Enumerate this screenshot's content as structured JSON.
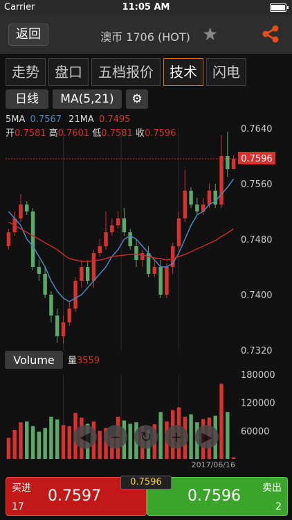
{
  "status": {
    "carrier": "Carrier",
    "time": "11:05 AM"
  },
  "header": {
    "back": "返回",
    "title": "澳币 1706 (HOT)"
  },
  "tabs": [
    "走势",
    "盘口",
    "五档报价",
    "技术",
    "闪电"
  ],
  "toolbar": {
    "period": "日线",
    "indicator": "MA(5,21)"
  },
  "ma": {
    "ma5_label": "5MA",
    "ma5": "0.7567",
    "ma21_label": "21MA",
    "ma21": "0.7495"
  },
  "ohlc": {
    "open_label": "开",
    "open": "0.7581",
    "high_label": "高",
    "high": "0.7601",
    "low_label": "低",
    "low": "0.7581",
    "close_label": "收",
    "close": "0.7596"
  },
  "price_axis": {
    "ticks": [
      "0.7640",
      "0.7560",
      "0.7480",
      "0.7400",
      "0.7320"
    ],
    "current": "0.7596"
  },
  "volume": {
    "button": "Volume",
    "label": "量",
    "value": "3559",
    "ticks": [
      "180000",
      "120000",
      "60000"
    ],
    "date": "2017/06/16"
  },
  "trade": {
    "buy_label": "买进",
    "buy_qty": "17",
    "buy_price": "0.7597",
    "sell_label": "卖出",
    "sell_qty": "2",
    "sell_price": "0.7596",
    "last": "0.7596"
  },
  "colors": {
    "up": "#d6322e",
    "down": "#5aa86a",
    "ma5": "#4a88c8",
    "ma21": "#c82a2a",
    "accent": "#e07020"
  },
  "chart_data": {
    "type": "candlestick",
    "ylim": [
      0.732,
      0.764
    ],
    "open": [
      0.747,
      0.749,
      0.751,
      0.753,
      0.752,
      0.744,
      0.743,
      0.74,
      0.737,
      0.734,
      0.736,
      0.738,
      0.742,
      0.744,
      0.742,
      0.746,
      0.747,
      0.749,
      0.75,
      0.751,
      0.749,
      0.747,
      0.745,
      0.746,
      0.743,
      0.744,
      0.74,
      0.744,
      0.747,
      0.751,
      0.755,
      0.753,
      0.752,
      0.753,
      0.755,
      0.753,
      0.76,
      0.7581
    ],
    "close": [
      0.749,
      0.751,
      0.753,
      0.752,
      0.744,
      0.743,
      0.74,
      0.737,
      0.734,
      0.736,
      0.738,
      0.742,
      0.744,
      0.742,
      0.746,
      0.747,
      0.749,
      0.75,
      0.751,
      0.749,
      0.747,
      0.745,
      0.746,
      0.743,
      0.744,
      0.74,
      0.744,
      0.747,
      0.751,
      0.755,
      0.753,
      0.752,
      0.753,
      0.755,
      0.753,
      0.76,
      0.7581,
      0.7596
    ],
    "high": [
      0.7495,
      0.752,
      0.7545,
      0.7535,
      0.7525,
      0.745,
      0.744,
      0.7405,
      0.738,
      0.737,
      0.739,
      0.7425,
      0.745,
      0.745,
      0.7465,
      0.748,
      0.752,
      0.751,
      0.752,
      0.7525,
      0.7495,
      0.748,
      0.7465,
      0.747,
      0.745,
      0.745,
      0.7445,
      0.7475,
      0.752,
      0.758,
      0.7555,
      0.754,
      0.754,
      0.756,
      0.756,
      0.763,
      0.7635,
      0.7601
    ],
    "low": [
      0.7465,
      0.7485,
      0.7505,
      0.7515,
      0.7435,
      0.742,
      0.7395,
      0.736,
      0.733,
      0.733,
      0.7355,
      0.7375,
      0.741,
      0.7415,
      0.741,
      0.7455,
      0.7465,
      0.7485,
      0.7495,
      0.7485,
      0.7465,
      0.744,
      0.744,
      0.7425,
      0.7425,
      0.7395,
      0.7395,
      0.743,
      0.7465,
      0.7505,
      0.7525,
      0.7515,
      0.7515,
      0.7525,
      0.7525,
      0.7525,
      0.757,
      0.7581
    ],
    "ma5": [
      0.752,
      0.751,
      0.75,
      0.748,
      0.747,
      0.7455,
      0.744,
      0.742,
      0.7405,
      0.7395,
      0.739,
      0.7395,
      0.74,
      0.741,
      0.742,
      0.743,
      0.744,
      0.7455,
      0.7465,
      0.748,
      0.7485,
      0.748,
      0.747,
      0.746,
      0.745,
      0.744,
      0.744,
      0.7445,
      0.746,
      0.748,
      0.75,
      0.7515,
      0.752,
      0.753,
      0.7535,
      0.7545,
      0.7555,
      0.7567
    ],
    "ma21": [
      0.7505,
      0.75,
      0.7495,
      0.749,
      0.7485,
      0.748,
      0.7475,
      0.747,
      0.7465,
      0.7458,
      0.7452,
      0.745,
      0.7448,
      0.7448,
      0.7449,
      0.745,
      0.7452,
      0.7455,
      0.7456,
      0.7457,
      0.7458,
      0.7458,
      0.7457,
      0.7455,
      0.7453,
      0.7452,
      0.745,
      0.7452,
      0.7455,
      0.7458,
      0.7462,
      0.7466,
      0.747,
      0.7474,
      0.7478,
      0.7484,
      0.7489,
      0.7495
    ],
    "volume": [
      45000,
      62000,
      78000,
      80000,
      70000,
      58000,
      66000,
      90000,
      84000,
      72000,
      70000,
      98000,
      88000,
      75000,
      80000,
      60000,
      66000,
      50000,
      90000,
      82000,
      75000,
      78000,
      70000,
      62000,
      74000,
      100000,
      80000,
      104000,
      110000,
      90000,
      95000,
      78000,
      85000,
      88000,
      92000,
      160000,
      100000,
      3559
    ],
    "vlim": [
      0,
      180000
    ]
  }
}
